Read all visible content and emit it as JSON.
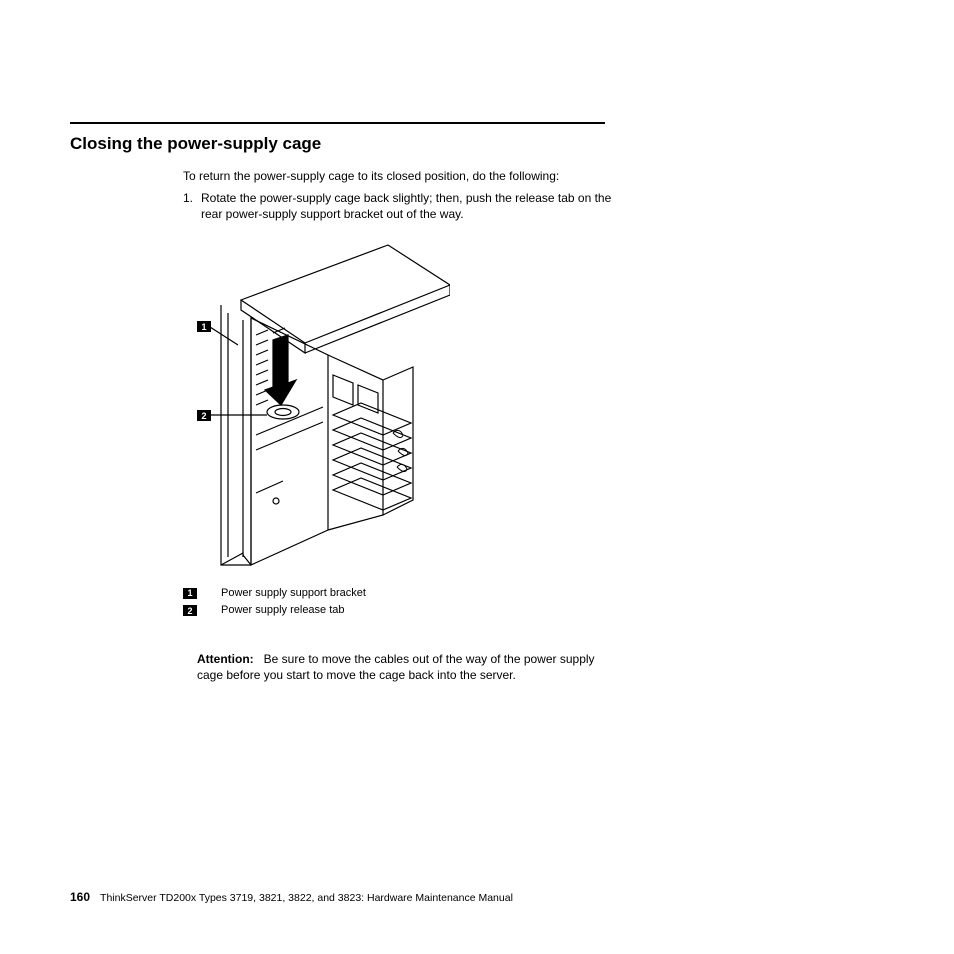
{
  "heading": "Closing the power-supply cage",
  "intro": "To return the power-supply cage to its closed position, do the following:",
  "steps": [
    {
      "num": "1.",
      "text": "Rotate the power-supply cage back slightly; then, push the release tab on the rear power-supply support bracket out of the way."
    }
  ],
  "legend": [
    {
      "badge": "1",
      "label": "Power supply support bracket"
    },
    {
      "badge": "2",
      "label": "Power supply release tab"
    }
  ],
  "attention": {
    "label": "Attention:",
    "text": "Be sure to move the cables out of the way of the power supply cage before you start to move the cage back into the server."
  },
  "footer": {
    "page": "160",
    "title": "ThinkServer TD200x Types 3719, 3821, 3822, and 3823: Hardware Maintenance Manual"
  },
  "callouts": {
    "c1": "1",
    "c2": "2"
  }
}
